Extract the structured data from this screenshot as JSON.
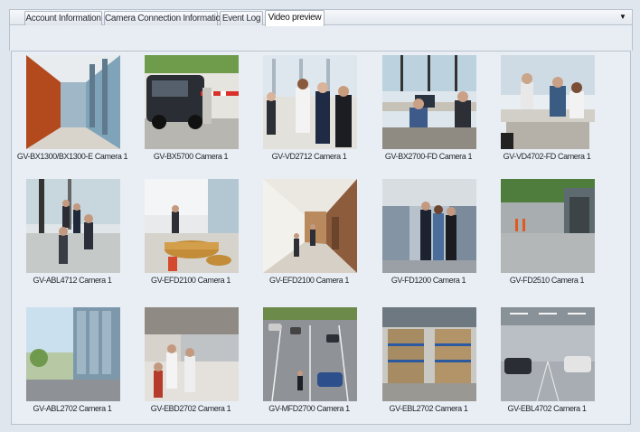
{
  "tabs": [
    {
      "label": "Account Information"
    },
    {
      "label": "Camera Connection Information"
    },
    {
      "label": "Event Log"
    },
    {
      "label": "Video preview",
      "active": true
    }
  ],
  "dropdown_icon": "triangle-down-icon",
  "cameras": [
    {
      "caption": "GV-BX1300/BX1300-E Camera 1",
      "scene": "corridor"
    },
    {
      "caption": "GV-BX5700 Camera 1",
      "scene": "parking-gate"
    },
    {
      "caption": "GV-VD2712 Camera 1",
      "scene": "business-people"
    },
    {
      "caption": "GV-BX2700-FD Camera 1",
      "scene": "office"
    },
    {
      "caption": "GV-VD4702-FD Camera 1",
      "scene": "meeting"
    },
    {
      "caption": "GV-ABL4712 Camera 1",
      "scene": "lobby-walk"
    },
    {
      "caption": "GV-EFD2100 Camera 1",
      "scene": "lobby-seats"
    },
    {
      "caption": "GV-EFD2100 Camera 1",
      "scene": "hallway"
    },
    {
      "caption": "GV-FD1200 Camera 1",
      "scene": "warehouse-people"
    },
    {
      "caption": "GV-FD2510 Camera 1",
      "scene": "loading-dock"
    },
    {
      "caption": "GV-ABL2702 Camera 1",
      "scene": "exterior"
    },
    {
      "caption": "GV-EBD2702 Camera 1",
      "scene": "kitchen"
    },
    {
      "caption": "GV-MFD2700 Camera 1",
      "scene": "parking-lot"
    },
    {
      "caption": "GV-EBL2702 Camera 1",
      "scene": "warehouse-shelves"
    },
    {
      "caption": "GV-EBL4702 Camera 1",
      "scene": "garage"
    }
  ]
}
